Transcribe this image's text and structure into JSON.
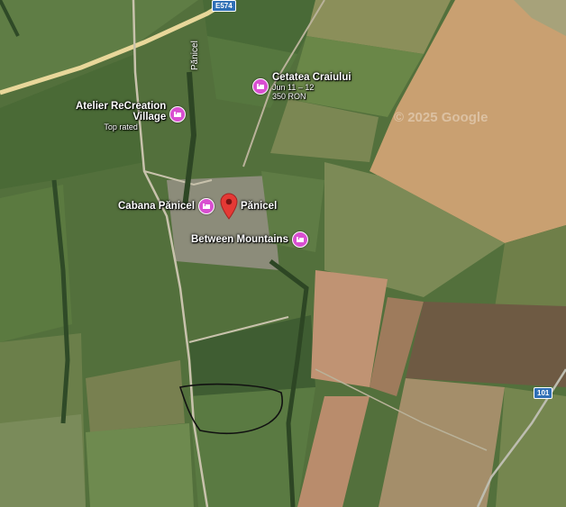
{
  "map": {
    "road_shields": {
      "e574": "E574",
      "r101": "101"
    },
    "street_label": "Pănicel",
    "watermark": "© 2025 Google",
    "pin": {
      "name": "Pănicel",
      "color": "#e53935"
    },
    "pois": [
      {
        "name": "Cetatea Craiului",
        "detail_1": "Jun 11 – 12",
        "detail_2": "350 RON",
        "icon": "hotel-icon"
      },
      {
        "name": "Atelier ReCreation",
        "name_2": "Village",
        "detail_1": "Top rated",
        "icon": "hotel-icon"
      },
      {
        "name": "Cabana Pănicel",
        "icon": "hotel-icon"
      },
      {
        "name": "Between Mountains",
        "icon": "hotel-icon"
      }
    ],
    "colors": {
      "poi": "#d94fd1",
      "shield": "#2f6fb6",
      "road_main": "#e8d79a"
    }
  }
}
